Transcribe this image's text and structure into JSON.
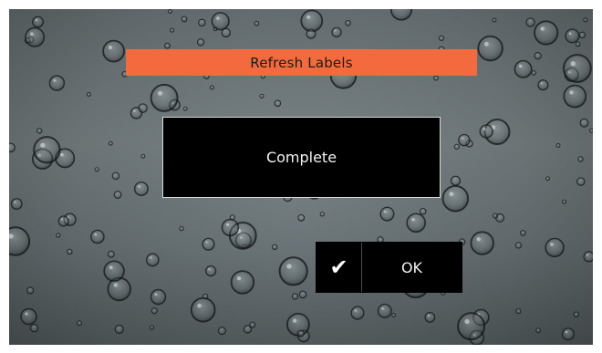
{
  "dialog": {
    "title": "Refresh Labels",
    "message": "Complete"
  },
  "actions": {
    "ok_label": "OK",
    "ok_icon": "checkmark-icon",
    "ok_icon_glyph": "✔"
  },
  "background": {
    "theme": "raindrops-on-glass"
  },
  "colors": {
    "title_bar": "#f26a3d",
    "dialog_bg": "#000000",
    "dialog_border": "#d8d8d8"
  }
}
